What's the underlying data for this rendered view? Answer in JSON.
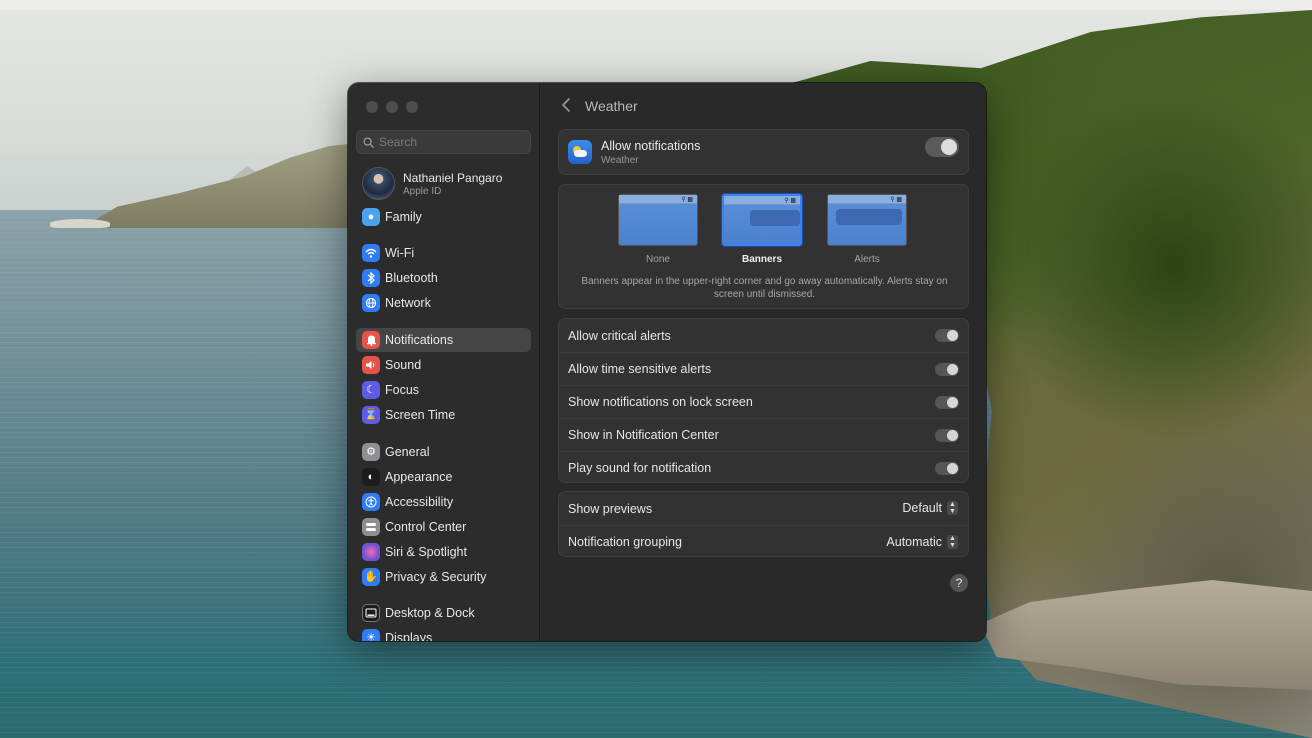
{
  "window": {
    "title": "Weather",
    "back_icon": "chevron-left-icon"
  },
  "sidebar": {
    "search_placeholder": "Search",
    "profile": {
      "name": "Nathaniel Pangaro",
      "subtitle": "Apple ID"
    },
    "items": [
      {
        "label": "Family",
        "icon": "family-icon",
        "color": "#4aa3ef"
      },
      {
        "label": "Wi-Fi",
        "icon": "wifi-icon",
        "color": "#2f7cf6"
      },
      {
        "label": "Bluetooth",
        "icon": "bluetooth-icon",
        "color": "#2f7cf6"
      },
      {
        "label": "Network",
        "icon": "globe-icon",
        "color": "#2f7cf6"
      },
      {
        "label": "Notifications",
        "icon": "bell-icon",
        "color": "#e5534b",
        "selected": true
      },
      {
        "label": "Sound",
        "icon": "speaker-icon",
        "color": "#e5534b"
      },
      {
        "label": "Focus",
        "icon": "moon-icon",
        "color": "#5e5ce6"
      },
      {
        "label": "Screen Time",
        "icon": "hourglass-icon",
        "color": "#5e5ce6"
      },
      {
        "label": "General",
        "icon": "gear-icon",
        "color": "#8e8e93"
      },
      {
        "label": "Appearance",
        "icon": "appearance-icon",
        "color": "#1c1c1e"
      },
      {
        "label": "Accessibility",
        "icon": "accessibility-icon",
        "color": "#2f7cf6"
      },
      {
        "label": "Control Center",
        "icon": "control-center-icon",
        "color": "#8e8e93"
      },
      {
        "label": "Siri & Spotlight",
        "icon": "siri-icon",
        "color": "#7a4fd6"
      },
      {
        "label": "Privacy & Security",
        "icon": "hand-icon",
        "color": "#2f7cf6"
      },
      {
        "label": "Desktop & Dock",
        "icon": "dock-icon",
        "color": "#1c1c1e"
      },
      {
        "label": "Displays",
        "icon": "display-icon",
        "color": "#2f7cf6"
      }
    ]
  },
  "allow": {
    "title": "Allow notifications",
    "subtitle": "Weather",
    "app_icon": "weather-icon",
    "enabled": true
  },
  "styles": {
    "options": [
      "None",
      "Banners",
      "Alerts"
    ],
    "selected": "Banners",
    "description": "Banners appear in the upper-right corner and go away automatically. Alerts stay on screen until dismissed."
  },
  "toggles": [
    {
      "label": "Allow critical alerts",
      "enabled": true
    },
    {
      "label": "Allow time sensitive alerts",
      "enabled": true
    },
    {
      "label": "Show notifications on lock screen",
      "enabled": true
    },
    {
      "label": "Show in Notification Center",
      "enabled": true
    },
    {
      "label": "Play sound for notification",
      "enabled": true
    }
  ],
  "selects": [
    {
      "label": "Show previews",
      "value": "Default"
    },
    {
      "label": "Notification grouping",
      "value": "Automatic"
    }
  ],
  "help_label": "?"
}
